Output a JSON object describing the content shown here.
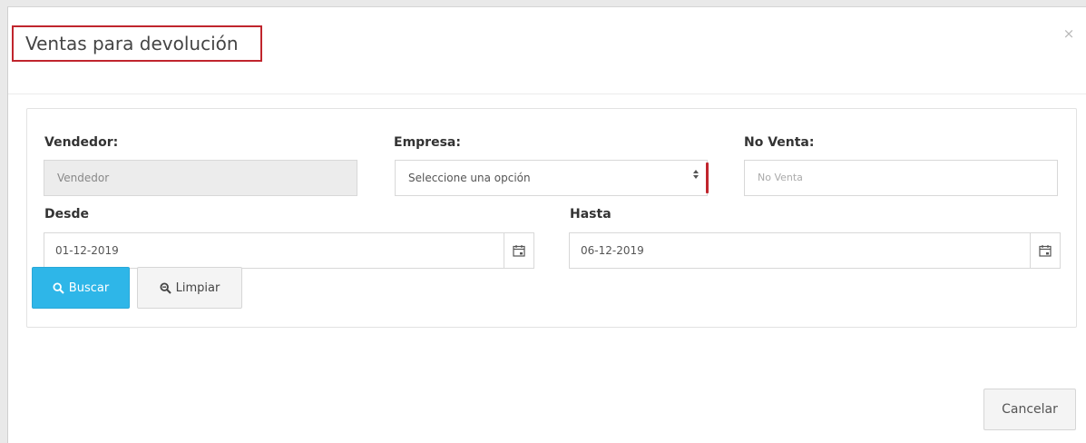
{
  "modal": {
    "title": "Ventas para devolución",
    "close_symbol": "×"
  },
  "filters": {
    "vendedor": {
      "label": "Vendedor:",
      "value": "Vendedor"
    },
    "empresa": {
      "label": "Empresa:",
      "selected": "Seleccione una opción"
    },
    "no_venta": {
      "label": "No Venta:",
      "placeholder": "No Venta"
    },
    "desde": {
      "label": "Desde",
      "value": "01-12-2019"
    },
    "hasta": {
      "label": "Hasta",
      "value": "06-12-2019"
    }
  },
  "buttons": {
    "search_label": "Buscar",
    "clear_label": "Limpiar",
    "cancel_label": "Cancelar"
  },
  "icons": {
    "search": "search-icon",
    "clear": "search-icon",
    "calendar": "calendar-icon",
    "select_arrows": "updown-arrows-icon"
  },
  "colors": {
    "title_highlight": "#c0252d",
    "primary_button": "#2eb6e8"
  }
}
